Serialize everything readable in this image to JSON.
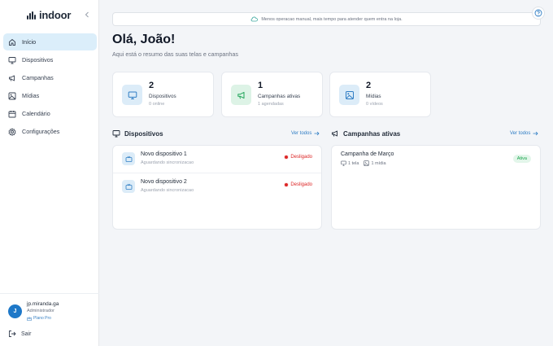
{
  "app": {
    "logo_text": "indoor"
  },
  "sidebar": {
    "items": [
      {
        "label": "Início",
        "icon": "home-icon",
        "active": true
      },
      {
        "label": "Dispositivos",
        "icon": "monitor-icon",
        "active": false
      },
      {
        "label": "Campanhas",
        "icon": "megaphone-icon",
        "active": false
      },
      {
        "label": "Mídias",
        "icon": "image-icon",
        "active": false
      },
      {
        "label": "Calendário",
        "icon": "calendar-icon",
        "active": false
      },
      {
        "label": "Configurações",
        "icon": "gear-icon",
        "active": false
      }
    ],
    "user": {
      "initial": "J",
      "name": "jp.miranda.ga",
      "role": "Administrador",
      "plan": "Plano Pro"
    },
    "logout_label": "Sair"
  },
  "banner": {
    "text": "Menos operacao manual, mais tempo para atender quem entra na loja."
  },
  "main": {
    "greeting": "Olá, João!",
    "subtitle": "Aqui está o resumo das suas telas e campanhas"
  },
  "stats": [
    {
      "value": "2",
      "label": "Dispositivos",
      "sub": "0 online"
    },
    {
      "value": "1",
      "label": "Campanhas ativas",
      "sub": "1 agendadas"
    },
    {
      "value": "2",
      "label": "Mídias",
      "sub": "0 vídeos"
    }
  ],
  "devices_section": {
    "title": "Dispositivos",
    "see_all": "Ver todos",
    "items": [
      {
        "name": "Novo dispositivo 1",
        "sync": "Aguardando sincronizacao",
        "status": "Desligado"
      },
      {
        "name": "Novo dispositivo 2",
        "sync": "Aguardando sincronizacao",
        "status": "Desligado"
      }
    ]
  },
  "campaigns_section": {
    "title": "Campanhas ativas",
    "see_all": "Ver todos",
    "items": [
      {
        "name": "Campanha de Março",
        "screens": "1 tela",
        "media": "1 mídia",
        "status": "Ativa"
      }
    ]
  },
  "colors": {
    "accent": "#2f7dc4",
    "active_nav_bg": "#dbeefa",
    "offline": "#dc2626",
    "active_badge": "#16a34a"
  }
}
